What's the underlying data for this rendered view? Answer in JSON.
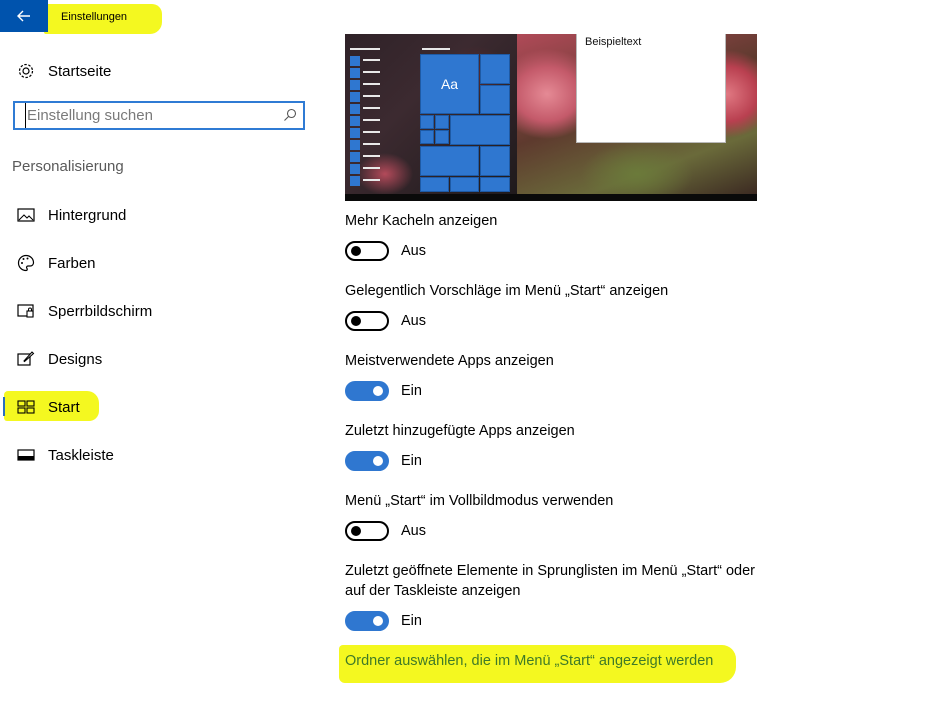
{
  "window": {
    "title": "Einstellungen"
  },
  "nav": {
    "home": "Startseite",
    "search_placeholder": "Einstellung suchen",
    "section": "Personalisierung",
    "items": [
      {
        "label": "Hintergrund",
        "icon": "picture-icon"
      },
      {
        "label": "Farben",
        "icon": "palette-icon"
      },
      {
        "label": "Sperrbildschirm",
        "icon": "lock-screen-icon"
      },
      {
        "label": "Designs",
        "icon": "brush-icon"
      },
      {
        "label": "Start",
        "icon": "start-tiles-icon",
        "selected": true
      },
      {
        "label": "Taskleiste",
        "icon": "taskbar-icon"
      }
    ]
  },
  "preview": {
    "tile_text": "Aa",
    "sample_text": "Beispieltext"
  },
  "settings": [
    {
      "label": "Mehr Kacheln anzeigen",
      "state": "Aus",
      "on": false
    },
    {
      "label": "Gelegentlich Vorschläge im Menü „Start“ anzeigen",
      "state": "Aus",
      "on": false
    },
    {
      "label": "Meistverwendete Apps anzeigen",
      "state": "Ein",
      "on": true
    },
    {
      "label": "Zuletzt hinzugefügte Apps anzeigen",
      "state": "Ein",
      "on": true
    },
    {
      "label": "Menü „Start“ im Vollbildmodus verwenden",
      "state": "Aus",
      "on": false
    },
    {
      "label_line1": "Zuletzt geöffnete Elemente in Sprunglisten im Menü „Start“ oder",
      "label_line2": "auf der Taskleiste anzeigen",
      "state": "Ein",
      "on": true
    }
  ],
  "link": "Ordner auswählen, die im Menü „Start“ angezeigt werden",
  "colors": {
    "accent": "#2f77d0",
    "highlight": "#f4f820",
    "titlebar_back": "#0053ad",
    "link": "#3f7a28"
  }
}
